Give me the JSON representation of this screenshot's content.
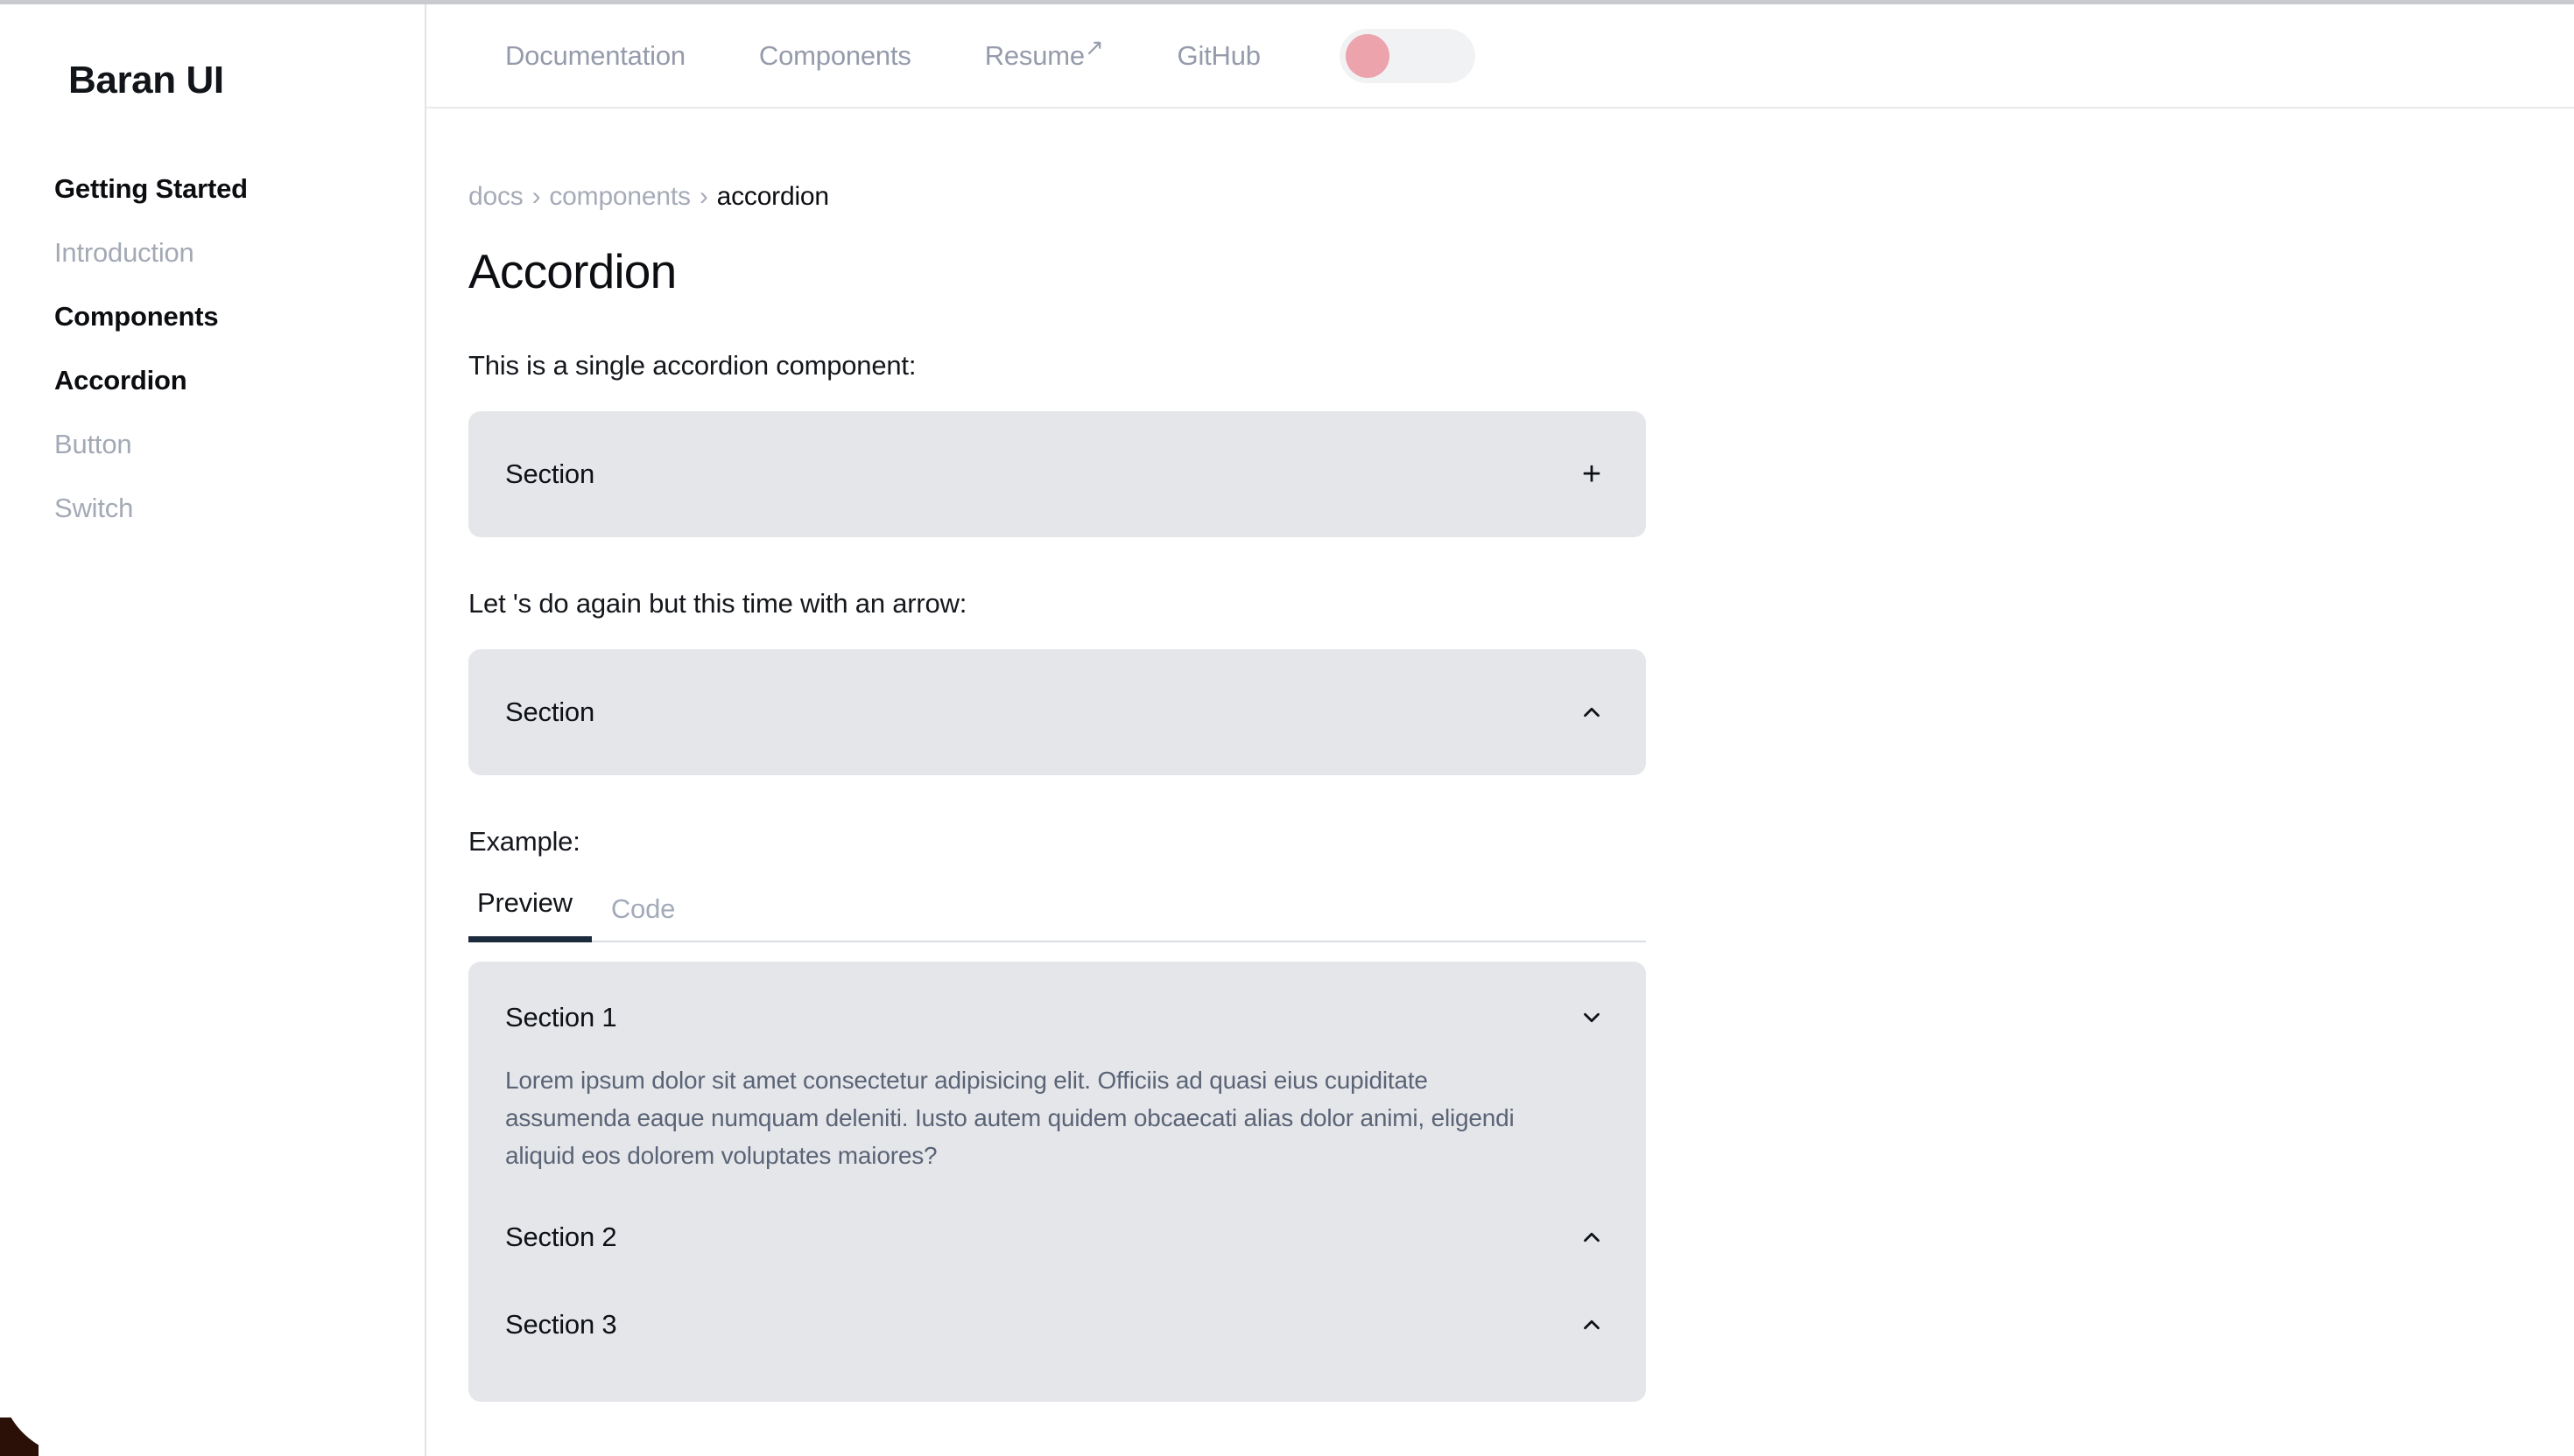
{
  "brand": {
    "name": "Baran UI"
  },
  "sidebar": {
    "items": [
      {
        "label": "Getting Started",
        "style": "strong"
      },
      {
        "label": "Introduction",
        "style": "muted"
      },
      {
        "label": "Components",
        "style": "strong"
      },
      {
        "label": "Accordion",
        "style": "strong"
      },
      {
        "label": "Button",
        "style": "muted"
      },
      {
        "label": "Switch",
        "style": "muted"
      }
    ]
  },
  "topnav": {
    "links": [
      {
        "label": "Documentation",
        "external": false
      },
      {
        "label": "Components",
        "external": false
      },
      {
        "label": "Resume",
        "external": true,
        "external_glyph": "↗"
      },
      {
        "label": "GitHub",
        "external": false
      }
    ],
    "theme_toggle": {
      "name": "theme-toggle",
      "state": "off",
      "knob_color": "#eda3ab",
      "track_color": "#f1f2f4"
    }
  },
  "breadcrumb": {
    "items": [
      {
        "label": "docs",
        "current": false
      },
      {
        "label": "components",
        "current": false
      },
      {
        "label": "accordion",
        "current": true
      }
    ],
    "separator": "›"
  },
  "page": {
    "title": "Accordion",
    "intro_single": "This is a single accordion component:",
    "intro_arrow": "Let 's do again but this time with an arrow:",
    "example_label": "Example:"
  },
  "accordion_single_plus": {
    "title": "Section",
    "icon": "plus-icon",
    "icon_glyph": "+"
  },
  "accordion_single_arrow": {
    "title": "Section",
    "icon": "chevron-up-icon"
  },
  "example_tabs": {
    "tabs": [
      {
        "label": "Preview",
        "active": true
      },
      {
        "label": "Code",
        "active": false
      }
    ],
    "active_underline_color": "#1c2b3e"
  },
  "accordion_multi": {
    "items": [
      {
        "title": "Section 1",
        "icon": "chevron-down-icon",
        "expanded": true,
        "body": "Lorem ipsum dolor sit amet consectetur adipisicing elit. Officiis ad quasi eius cupiditate assumenda eaque numquam deleniti. Iusto autem quidem obcaecati alias dolor animi, eligendi aliquid eos dolorem voluptates maiores?"
      },
      {
        "title": "Section 2",
        "icon": "chevron-up-icon",
        "expanded": false,
        "body": ""
      },
      {
        "title": "Section 3",
        "icon": "chevron-up-icon",
        "expanded": false,
        "body": ""
      }
    ]
  },
  "colors": {
    "accordion_bg": "#e5e6ea",
    "muted_text": "#a3a9b5",
    "body_text": "#5a6476",
    "accent_pink": "#eda3ab",
    "tab_active": "#1c2b3e"
  }
}
